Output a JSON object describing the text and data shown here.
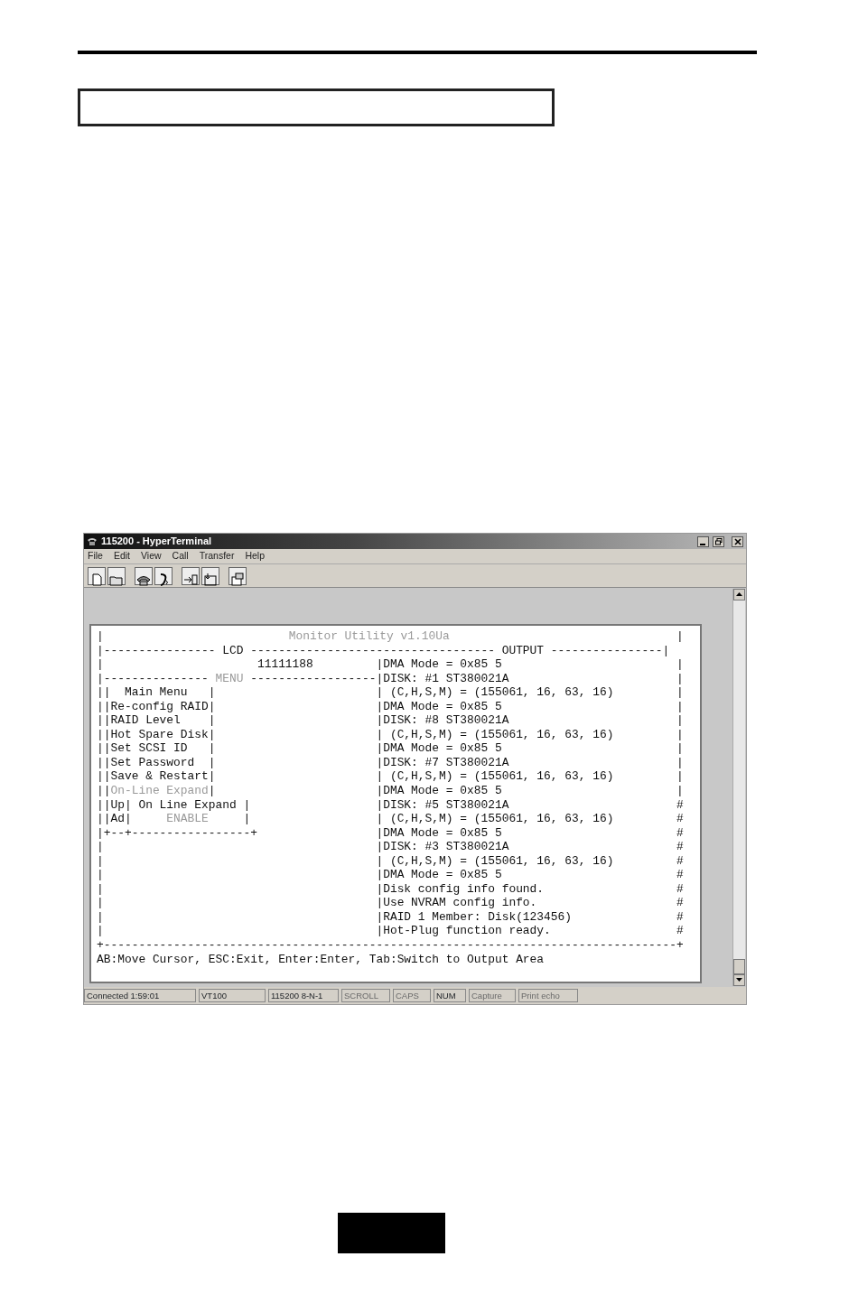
{
  "window": {
    "title": "115200 - HyperTerminal"
  },
  "menu": [
    "File",
    "Edit",
    "View",
    "Call",
    "Transfer",
    "Help"
  ],
  "terminal": {
    "lines": [
      {
        "kind": "full",
        "segments": [
          {
            "text": "|",
            "dim": false
          },
          {
            "text": "Monitor Utility v1.10Ua",
            "dim": true
          },
          {
            "text": "|",
            "dim": false
          }
        ]
      },
      {
        "kind": "full",
        "segments": [
          {
            "text": "|---------------- LCD ----------------------------------- OUTPUT ----------------|",
            "dim": false
          }
        ]
      },
      {
        "kind": "split",
        "left": [
          {
            "text": "|                      11111188",
            "dim": false
          }
        ],
        "right": "|DMA Mode = 0x85 5",
        "end": "|"
      },
      {
        "kind": "split",
        "left": [
          {
            "text": "|--------------- ",
            "dim": false
          },
          {
            "text": "MENU",
            "dim": true
          },
          {
            "text": " ------------------",
            "dim": false
          }
        ],
        "right": "|DISK: #1 ST380021A",
        "end": "|"
      },
      {
        "kind": "split",
        "left": [
          {
            "text": "||  Main Menu   |",
            "dim": false
          }
        ],
        "right": "| (C,H,S,M) = (155061, 16, 63, 16)",
        "end": "|"
      },
      {
        "kind": "split",
        "left": [
          {
            "text": "||Re-config RAID|",
            "dim": false
          }
        ],
        "right": "|DMA Mode = 0x85 5",
        "end": "|"
      },
      {
        "kind": "split",
        "left": [
          {
            "text": "||RAID Level    |",
            "dim": false
          }
        ],
        "right": "|DISK: #8 ST380021A",
        "end": "|"
      },
      {
        "kind": "split",
        "left": [
          {
            "text": "||Hot Spare Disk|",
            "dim": false
          }
        ],
        "right": "| (C,H,S,M) = (155061, 16, 63, 16)",
        "end": "|"
      },
      {
        "kind": "split",
        "left": [
          {
            "text": "||Set SCSI ID   |",
            "dim": false
          }
        ],
        "right": "|DMA Mode = 0x85 5",
        "end": "|"
      },
      {
        "kind": "split",
        "left": [
          {
            "text": "||Set Password  |",
            "dim": false
          }
        ],
        "right": "|DISK: #7 ST380021A",
        "end": "|"
      },
      {
        "kind": "split",
        "left": [
          {
            "text": "||Save & Restart|",
            "dim": false
          }
        ],
        "right": "| (C,H,S,M) = (155061, 16, 63, 16)",
        "end": "|"
      },
      {
        "kind": "split",
        "left": [
          {
            "text": "||",
            "dim": false
          },
          {
            "text": "On-Line Expand",
            "dim": true
          },
          {
            "text": "|",
            "dim": false
          }
        ],
        "right": "|DMA Mode = 0x85 5",
        "end": "|"
      },
      {
        "kind": "split",
        "left": [
          {
            "text": "||Up| On Line Expand |",
            "dim": false
          }
        ],
        "right": "|DISK: #5 ST380021A",
        "end": "#"
      },
      {
        "kind": "split",
        "left": [
          {
            "text": "||Ad|     ",
            "dim": false
          },
          {
            "text": "ENABLE",
            "dim": true
          },
          {
            "text": "     |",
            "dim": false
          }
        ],
        "right": "| (C,H,S,M) = (155061, 16, 63, 16)",
        "end": "#"
      },
      {
        "kind": "split",
        "left": [
          {
            "text": "|+--+-----------------+",
            "dim": false
          }
        ],
        "right": "|DMA Mode = 0x85 5",
        "end": "#"
      },
      {
        "kind": "split",
        "left": [
          {
            "text": "|",
            "dim": false
          }
        ],
        "right": "|DISK: #3 ST380021A",
        "end": "#"
      },
      {
        "kind": "split",
        "left": [
          {
            "text": "|",
            "dim": false
          }
        ],
        "right": "| (C,H,S,M) = (155061, 16, 63, 16)",
        "end": "#"
      },
      {
        "kind": "split",
        "left": [
          {
            "text": "|",
            "dim": false
          }
        ],
        "right": "|DMA Mode = 0x85 5",
        "end": "#"
      },
      {
        "kind": "split",
        "left": [
          {
            "text": "|",
            "dim": false
          }
        ],
        "right": "|Disk config info found.",
        "end": "#"
      },
      {
        "kind": "split",
        "left": [
          {
            "text": "|",
            "dim": false
          }
        ],
        "right": "|Use NVRAM config info.",
        "end": "#"
      },
      {
        "kind": "split",
        "left": [
          {
            "text": "|",
            "dim": false
          }
        ],
        "right": "|RAID 1 Member: Disk(123456)",
        "end": "#"
      },
      {
        "kind": "split",
        "left": [
          {
            "text": "|",
            "dim": false
          }
        ],
        "right": "|Hot-Plug function ready.",
        "end": "#"
      },
      {
        "kind": "full",
        "segments": [
          {
            "text": "+----------------------------------------------------------------------------------+",
            "dim": false
          }
        ]
      },
      {
        "kind": "full",
        "segments": [
          {
            "text": "AB:Move Cursor, ESC:Exit, Enter:Enter, Tab:Switch to Output Area",
            "dim": false
          }
        ]
      }
    ]
  },
  "status_bar": [
    {
      "text": "Connected 1:59:01",
      "on": true
    },
    {
      "text": "VT100",
      "on": true
    },
    {
      "text": "115200 8-N-1",
      "on": true
    },
    {
      "text": "SCROLL",
      "on": false
    },
    {
      "text": "CAPS",
      "on": false
    },
    {
      "text": "NUM",
      "on": true
    },
    {
      "text": "Capture",
      "on": false
    },
    {
      "text": "Print echo",
      "on": false
    }
  ]
}
